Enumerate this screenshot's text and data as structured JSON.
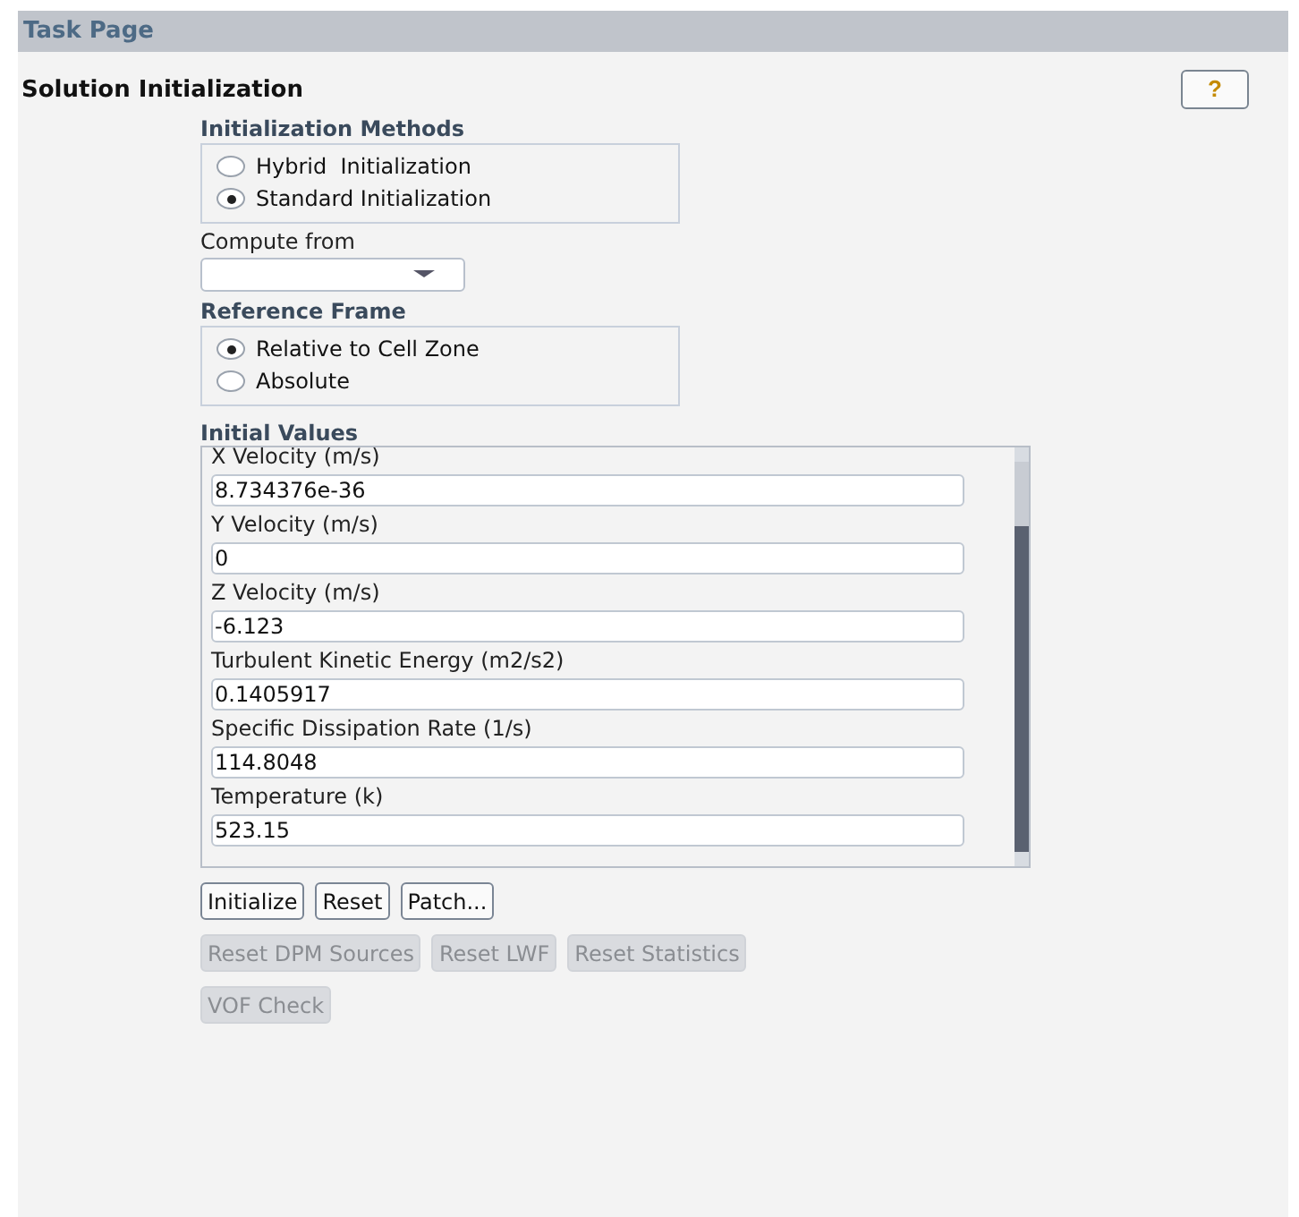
{
  "panel": {
    "title": "Task Page"
  },
  "page": {
    "title": "Solution Initialization",
    "help": "?"
  },
  "initialization_methods": {
    "title": "Initialization Methods",
    "options": [
      {
        "label": "Hybrid  Initialization",
        "selected": false
      },
      {
        "label": "Standard Initialization",
        "selected": true
      }
    ]
  },
  "compute_from": {
    "label": "Compute from"
  },
  "reference_frame": {
    "title": "Reference Frame",
    "options": [
      {
        "label": "Relative to Cell Zone",
        "selected": true
      },
      {
        "label": "Absolute",
        "selected": false
      }
    ]
  },
  "initial_values": {
    "title": "Initial Values",
    "fields": [
      {
        "label": "X Velocity (m/s)",
        "value": "8.734376e-36"
      },
      {
        "label": "Y Velocity (m/s)",
        "value": "0"
      },
      {
        "label": "Z Velocity (m/s)",
        "value": "-6.123"
      },
      {
        "label": "Turbulent Kinetic Energy (m2/s2)",
        "value": "0.1405917"
      },
      {
        "label": "Specific Dissipation Rate (1/s)",
        "value": "114.8048"
      },
      {
        "label": "Temperature (k)",
        "value": "523.15"
      }
    ]
  },
  "button_rows": [
    [
      {
        "label": "Initialize",
        "disabled": false
      },
      {
        "label": "Reset",
        "disabled": false
      },
      {
        "label": "Patch...",
        "disabled": false
      }
    ],
    [
      {
        "label": "Reset DPM Sources",
        "disabled": true
      },
      {
        "label": "Reset LWF",
        "disabled": true
      },
      {
        "label": "Reset Statistics",
        "disabled": true
      }
    ],
    [
      {
        "label": "VOF Check",
        "disabled": true
      }
    ]
  ]
}
